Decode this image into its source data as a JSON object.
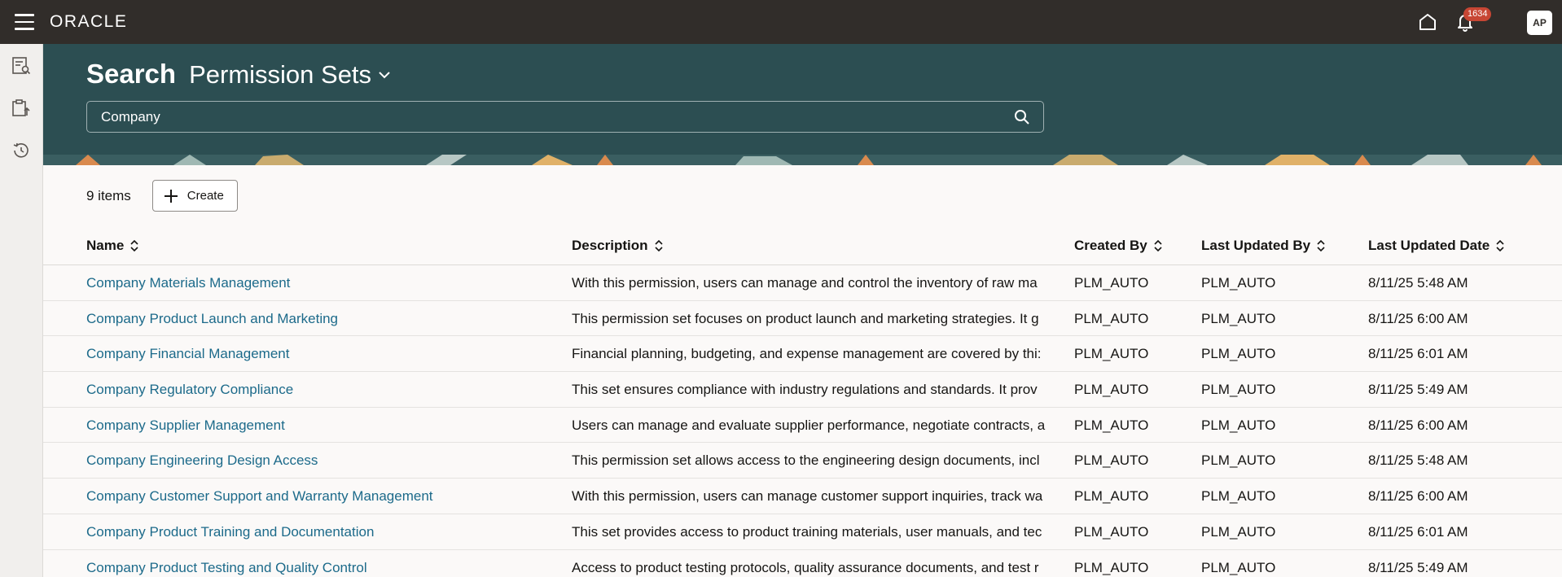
{
  "topbar": {
    "logo": "ORACLE",
    "notification_count": "1634",
    "avatar_initials": "AP"
  },
  "header": {
    "title_prefix": "Search",
    "object_name": "Permission Sets",
    "search_value": "Company"
  },
  "toolbar": {
    "count_label": "9 items",
    "create_label": "Create"
  },
  "table": {
    "columns": [
      "Name",
      "Description",
      "Created By",
      "Last Updated By",
      "Last Updated Date"
    ],
    "rows": [
      {
        "name": "Company Materials Management",
        "description": "With this permission, users can manage and control the inventory of raw ma",
        "created_by": "PLM_AUTO",
        "last_updated_by": "PLM_AUTO",
        "last_updated_date": "8/11/25 5:48 AM"
      },
      {
        "name": "Company Product Launch and Marketing",
        "description": "This permission set focuses on product launch and marketing strategies. It g",
        "created_by": "PLM_AUTO",
        "last_updated_by": "PLM_AUTO",
        "last_updated_date": "8/11/25 6:00 AM"
      },
      {
        "name": "Company Financial Management",
        "description": "Financial planning, budgeting, and expense management are covered by thi:",
        "created_by": "PLM_AUTO",
        "last_updated_by": "PLM_AUTO",
        "last_updated_date": "8/11/25 6:01 AM"
      },
      {
        "name": "Company Regulatory Compliance",
        "description": "This set ensures compliance with industry regulations and standards. It prov",
        "created_by": "PLM_AUTO",
        "last_updated_by": "PLM_AUTO",
        "last_updated_date": "8/11/25 5:49 AM"
      },
      {
        "name": "Company Supplier Management",
        "description": "Users can manage and evaluate supplier performance, negotiate contracts, a",
        "created_by": "PLM_AUTO",
        "last_updated_by": "PLM_AUTO",
        "last_updated_date": "8/11/25 6:00 AM"
      },
      {
        "name": "Company Engineering Design Access",
        "description": "This permission set allows access to the engineering design documents, incl",
        "created_by": "PLM_AUTO",
        "last_updated_by": "PLM_AUTO",
        "last_updated_date": "8/11/25 5:48 AM"
      },
      {
        "name": "Company Customer Support and Warranty Management",
        "description": "With this permission, users can manage customer support inquiries, track wa",
        "created_by": "PLM_AUTO",
        "last_updated_by": "PLM_AUTO",
        "last_updated_date": "8/11/25 6:00 AM"
      },
      {
        "name": "Company Product Training and Documentation",
        "description": "This set provides access to product training materials, user manuals, and tec",
        "created_by": "PLM_AUTO",
        "last_updated_by": "PLM_AUTO",
        "last_updated_date": "8/11/25 6:01 AM"
      },
      {
        "name": "Company Product Testing and Quality Control",
        "description": "Access to product testing protocols, quality assurance documents, and test r",
        "created_by": "PLM_AUTO",
        "last_updated_by": "PLM_AUTO",
        "last_updated_date": "8/11/25 5:49 AM"
      }
    ]
  }
}
